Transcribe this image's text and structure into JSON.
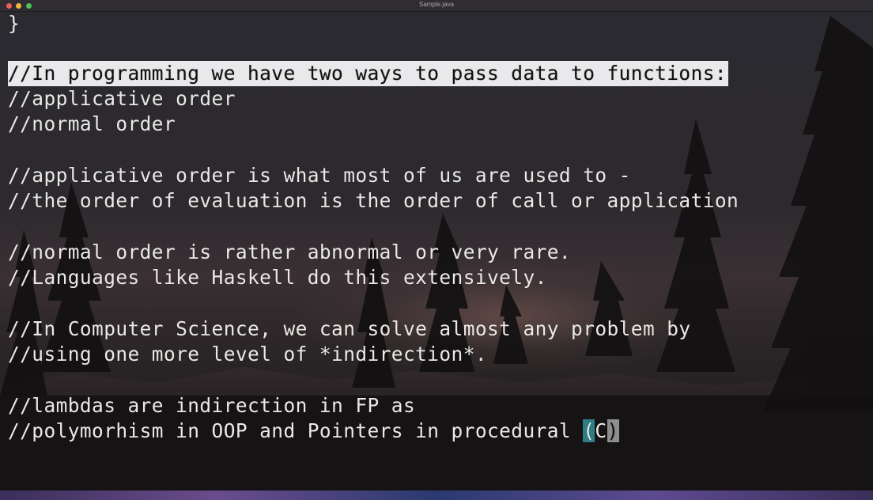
{
  "window": {
    "title": "Sample.java"
  },
  "editor": {
    "lines": [
      "}",
      "",
      "//In programming we have two ways to pass data to functions:",
      "//applicative order",
      "//normal order",
      "",
      "//applicative order is what most of us are used to -",
      "//the order of evaluation is the order of call or application",
      "",
      "//normal order is rather abnormal or very rare.",
      "//Languages like Haskell do this extensively.",
      "",
      "//In Computer Science, we can solve almost any problem by",
      "//using one more level of *indirection*.",
      "",
      "//lambdas are indirection in FP as"
    ],
    "last_line": {
      "prefix": "//polymorhism in OOP and Pointers in procedural ",
      "open_paren": "(",
      "letter": "C",
      "close_paren": ")"
    },
    "selected_line_index": 2
  },
  "colors": {
    "text": "#ebe9e6",
    "selection": "#e9e8ea",
    "paren_highlight": "#2f7e86",
    "cursor": "#8e8e8e"
  }
}
